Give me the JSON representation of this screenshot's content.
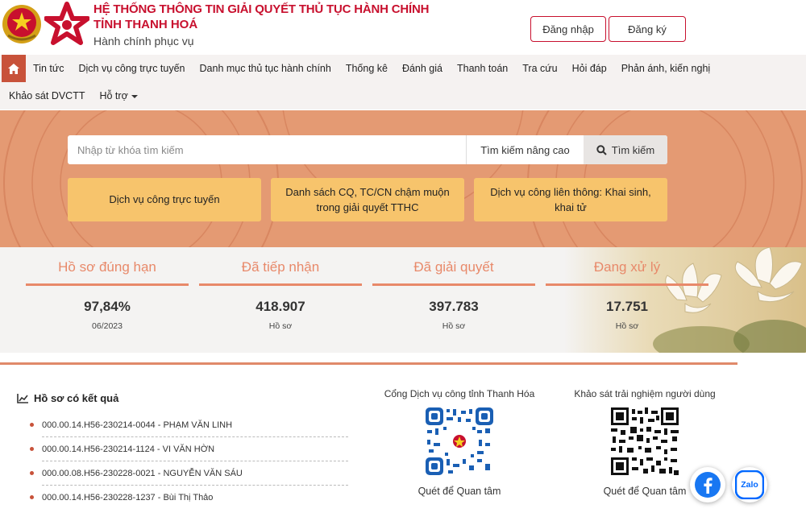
{
  "header": {
    "title_line1": "HỆ THỐNG THÔNG TIN GIẢI QUYẾT THỦ TỤC HÀNH CHÍNH",
    "title_line2": "TỈNH THANH HOÁ",
    "subtitle": "Hành chính phục vụ",
    "login_label": "Đăng nhập",
    "register_label": "Đăng ký"
  },
  "nav": {
    "home_icon": "home-icon",
    "items_row1": [
      "Tin tức",
      "Dịch vụ công trực tuyến",
      "Danh mục thủ tục hành chính",
      "Thống kê",
      "Đánh giá",
      "Thanh toán",
      "Tra cứu",
      "Hỏi đáp",
      "Phản ánh, kiến nghị"
    ],
    "items_row2": [
      "Khảo sát DVCTT",
      "Hỗ trợ"
    ]
  },
  "search": {
    "placeholder": "Nhập từ khóa tìm kiếm",
    "advanced_label": "Tìm kiếm nâng cao",
    "button_label": "Tìm kiếm"
  },
  "quick_links": [
    "Dịch vụ công trực tuyến",
    "Danh sách CQ, TC/CN chậm muộn trong giải quyết TTHC",
    "Dịch vụ công liên thông: Khai sinh, khai tử"
  ],
  "stats": [
    {
      "title": "Hồ sơ đúng hạn",
      "value": "97,84%",
      "sub": "06/2023"
    },
    {
      "title": "Đã tiếp nhận",
      "value": "418.907",
      "sub": "Hồ sơ"
    },
    {
      "title": "Đã giải quyết",
      "value": "397.783",
      "sub": "Hồ sơ"
    },
    {
      "title": "Đang xử lý",
      "value": "17.751",
      "sub": "Hồ sơ"
    }
  ],
  "results": {
    "title": "Hồ sơ có kết quả",
    "items": [
      "000.00.14.H56-230214-0044 - PHẠM VĂN LINH",
      "000.00.14.H56-230214-1124 - VI VĂN HỜN",
      "000.00.08.H56-230228-0021 - NGUYỄN VĂN SÁU",
      "000.00.14.H56-230228-1237 - Bùi Thị Thảo"
    ]
  },
  "qr": [
    {
      "label": "Cổng Dịch vụ công tỉnh Thanh Hóa",
      "caption": "Quét để Quan tâm"
    },
    {
      "label": "Khảo sát trải nghiệm người dùng",
      "caption": "Quét để Quan tâm"
    }
  ],
  "floating": {
    "facebook_icon": "facebook-icon",
    "zalo_label": "Zalo"
  },
  "colors": {
    "brand_red": "#c8102e",
    "banner": "#e49a73",
    "quick_button": "#f7c46c",
    "stat_accent": "#e8896a"
  }
}
